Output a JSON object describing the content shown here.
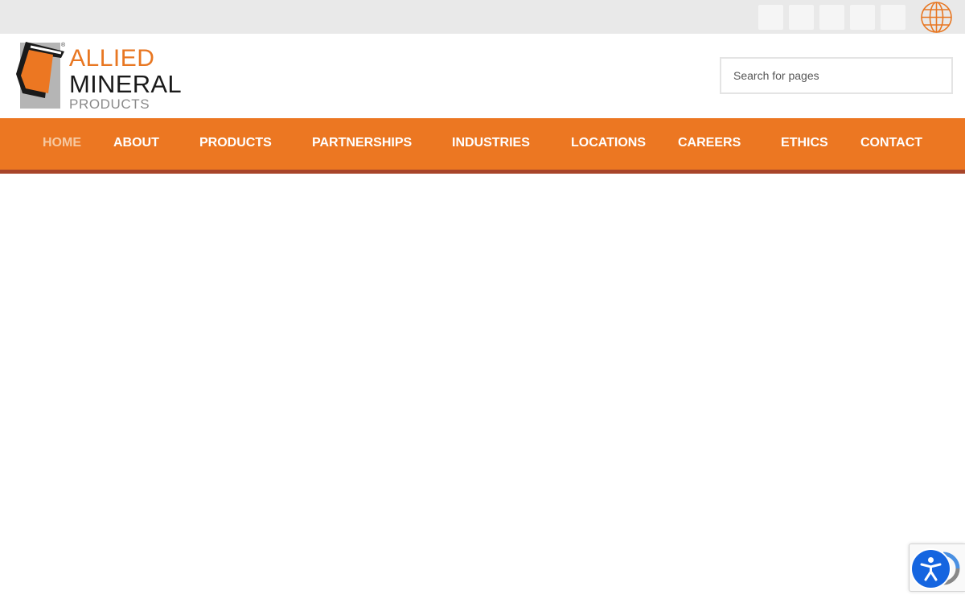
{
  "topbar": {
    "social_icons": [
      "social-icon-1",
      "social-icon-2",
      "social-icon-3",
      "social-icon-4",
      "social-icon-5"
    ],
    "language_icon": "globe-icon"
  },
  "brand": {
    "line1": "ALLIED",
    "line2": "MINERAL",
    "line3": "PRODUCTS",
    "registered": "®",
    "colors": {
      "orange": "#e87722",
      "dark": "#1a1a1a",
      "grey": "#8a8a8a"
    }
  },
  "search": {
    "placeholder": "Search for pages",
    "value": ""
  },
  "nav": {
    "items": [
      {
        "label": "HOME",
        "active": true
      },
      {
        "label": "ABOUT"
      },
      {
        "label": "PRODUCTS"
      },
      {
        "label": "PARTNERSHIPS"
      },
      {
        "label": "INDUSTRIES"
      },
      {
        "label": "LOCATIONS"
      },
      {
        "label": "CAREERS"
      },
      {
        "label": "ETHICS"
      },
      {
        "label": "CONTACT"
      }
    ],
    "colors": {
      "bar": "#ec7722",
      "strip": "#a8452a",
      "active_text": "#f6c9a1"
    }
  },
  "widgets": {
    "accessibility_icon": "accessibility-icon",
    "recaptcha_icon": "recaptcha-icon"
  }
}
